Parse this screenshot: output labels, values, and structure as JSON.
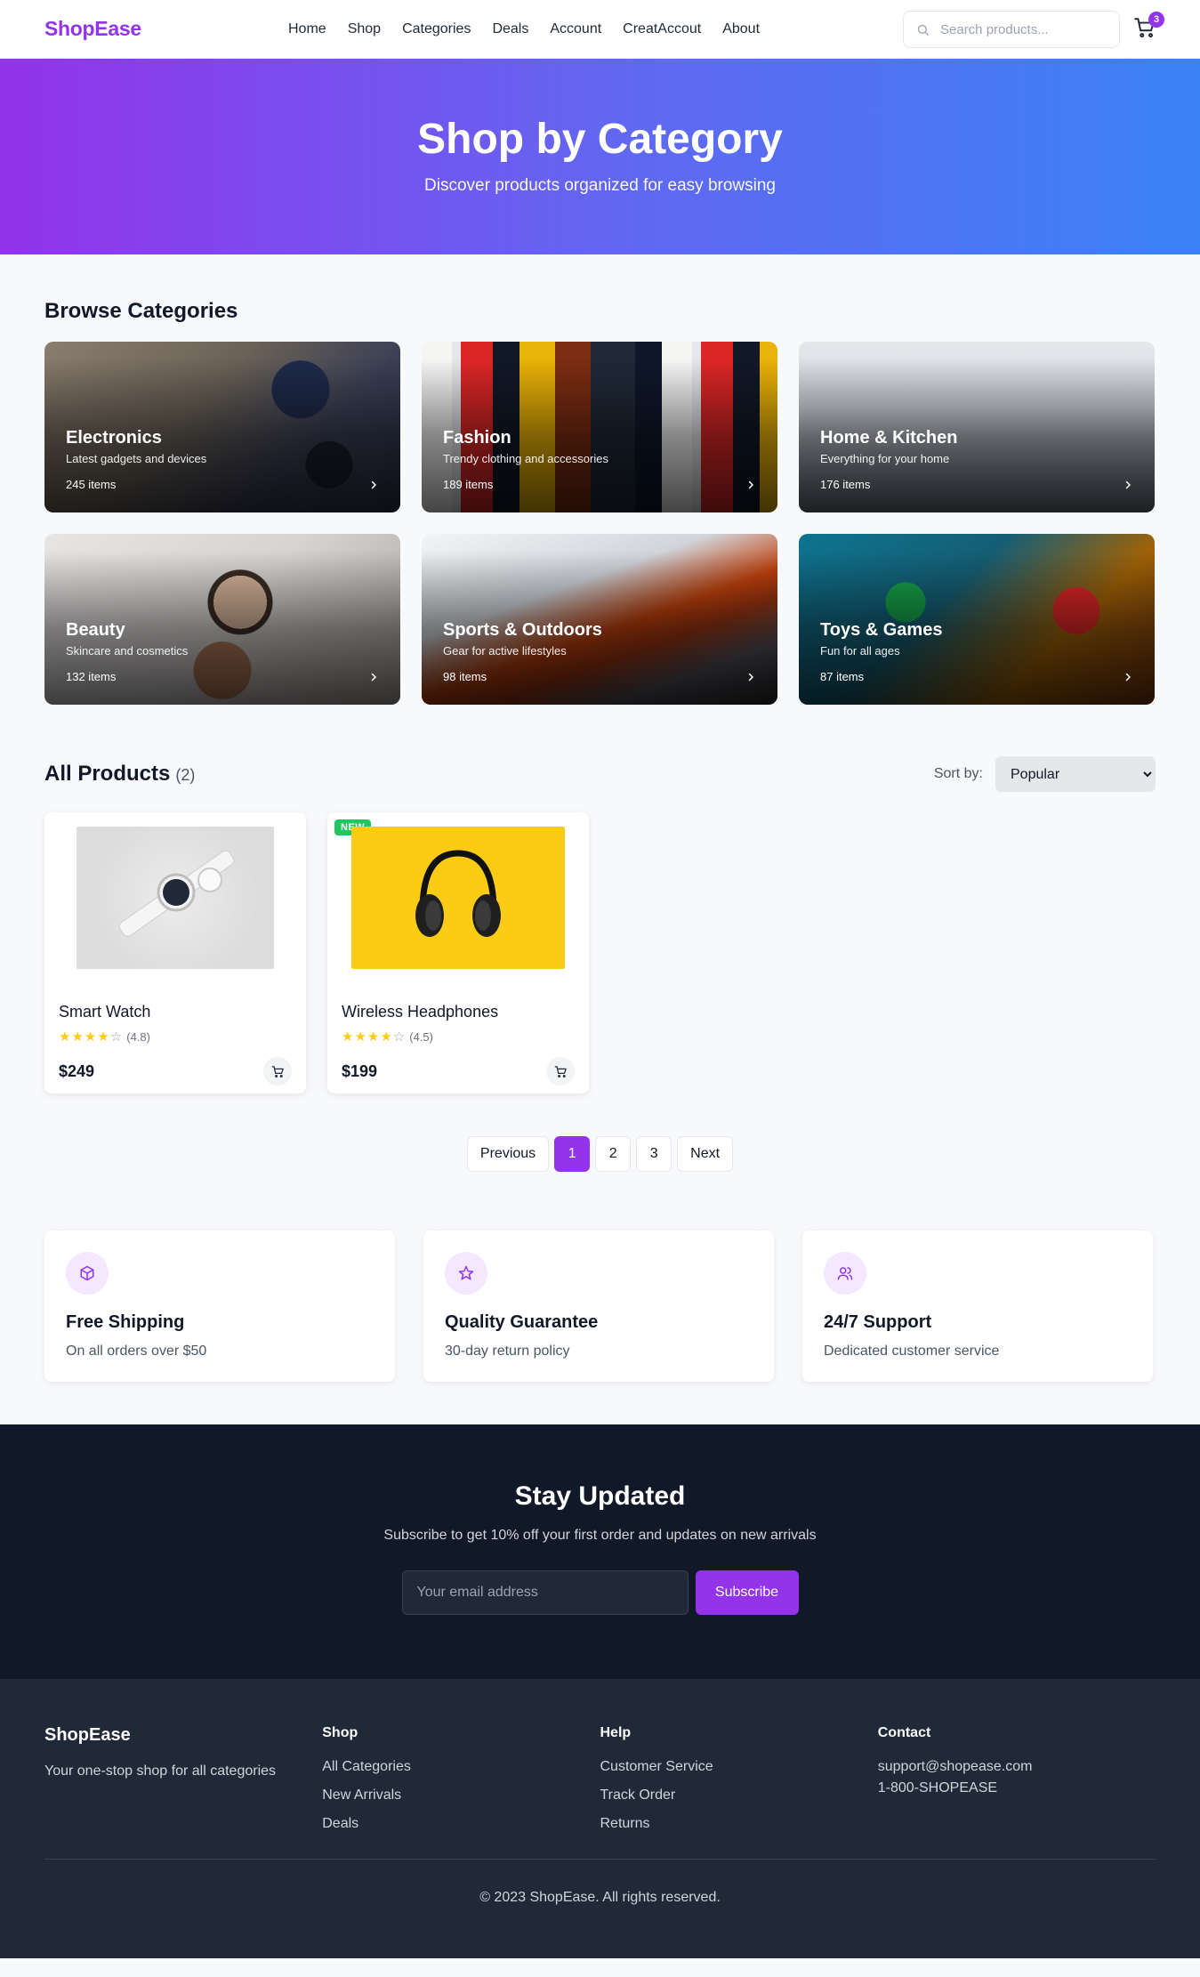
{
  "header": {
    "logo": "ShopEase",
    "nav": [
      "Home",
      "Shop",
      "Categories",
      "Deals",
      "Account",
      "CreatAccout",
      "About"
    ],
    "search_placeholder": "Search products...",
    "cart_count": "3"
  },
  "hero": {
    "title": "Shop by Category",
    "subtitle": "Discover products organized for easy browsing"
  },
  "categories": {
    "title": "Browse Categories",
    "items": [
      {
        "name": "Electronics",
        "desc": "Latest gadgets and devices",
        "count": "245 items"
      },
      {
        "name": "Fashion",
        "desc": "Trendy clothing and accessories",
        "count": "189 items"
      },
      {
        "name": "Home & Kitchen",
        "desc": "Everything for your home",
        "count": "176 items"
      },
      {
        "name": "Beauty",
        "desc": "Skincare and cosmetics",
        "count": "132 items"
      },
      {
        "name": "Sports & Outdoors",
        "desc": "Gear for active lifestyles",
        "count": "98 items"
      },
      {
        "name": "Toys & Games",
        "desc": "Fun for all ages",
        "count": "87 items"
      }
    ]
  },
  "products": {
    "title": "All Products",
    "count": "(2)",
    "sort_label": "Sort by:",
    "sort_value": "Popular",
    "items": [
      {
        "name": "Smart Watch",
        "rating": "(4.8)",
        "price": "$249",
        "badge": ""
      },
      {
        "name": "Wireless Headphones",
        "rating": "(4.5)",
        "price": "$199",
        "badge": "NEW"
      }
    ]
  },
  "pagination": {
    "prev": "Previous",
    "pages": [
      "1",
      "2",
      "3"
    ],
    "next": "Next"
  },
  "features": [
    {
      "icon": "box-icon",
      "title": "Free Shipping",
      "desc": "On all orders over $50"
    },
    {
      "icon": "star-icon",
      "title": "Quality Guarantee",
      "desc": "30-day return policy"
    },
    {
      "icon": "users-icon",
      "title": "24/7 Support",
      "desc": "Dedicated customer service"
    }
  ],
  "newsletter": {
    "title": "Stay Updated",
    "subtitle": "Subscribe to get 10% off your first order and updates on new arrivals",
    "placeholder": "Your email address",
    "button": "Subscribe"
  },
  "footer": {
    "brand": "ShopEase",
    "tagline": "Your one-stop shop for all categories",
    "shop_title": "Shop",
    "shop_links": [
      "All Categories",
      "New Arrivals",
      "Deals"
    ],
    "help_title": "Help",
    "help_links": [
      "Customer Service",
      "Track Order",
      "Returns"
    ],
    "contact_title": "Contact",
    "email": "support@shopease.com",
    "phone": "1-800-SHOPEASE",
    "copyright": "© 2023 ShopEase. All rights reserved."
  },
  "colors": {
    "brand": "#9333ea",
    "hero_start": "#9333ea",
    "hero_end": "#3b82f6",
    "badge_new": "#22c55e",
    "star": "#facc15",
    "newsletter_bg": "#111827",
    "footer_bg": "#1f2937"
  }
}
